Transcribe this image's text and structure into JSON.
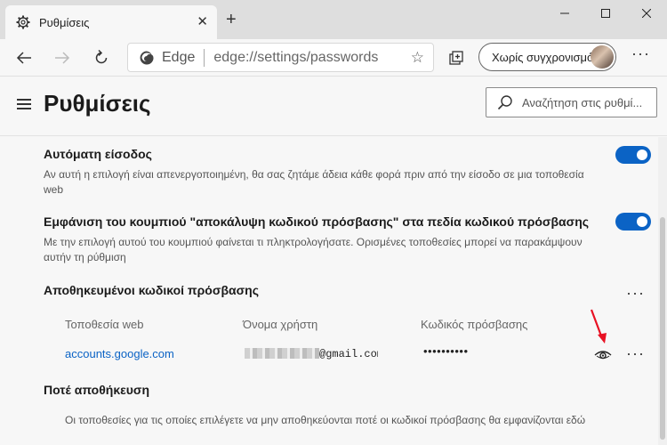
{
  "window": {
    "tab_title": "Ρυθμίσεις",
    "icons": {
      "tab": "gear-icon",
      "close": "close-icon",
      "new_tab": "plus-icon"
    }
  },
  "toolbar": {
    "omnibox_brand": "Edge",
    "url": "edge://settings/passwords",
    "profile_label": "Χωρίς συγχρονισμό",
    "icons": [
      "back-icon",
      "forward-icon",
      "refresh-icon",
      "edge-logo-icon",
      "favorite-star-icon",
      "collections-icon",
      "more-icon"
    ]
  },
  "header": {
    "title": "Ρυθμίσεις",
    "search_placeholder": "Αναζήτηση στις ρυθμί..."
  },
  "settings": {
    "auto_signin": {
      "title": "Αυτόματη είσοδος",
      "description": "Αν αυτή η επιλογή είναι απενεργοποιημένη, θα σας ζητάμε άδεια κάθε φορά πριν από την είσοδο σε μια τοποθεσία web",
      "enabled": true
    },
    "reveal_button": {
      "title": "Εμφάνιση του κουμπιού \"αποκάλυψη κωδικού πρόσβασης\" στα πεδία κωδικού πρόσβασης",
      "description": "Με την επιλογή αυτού του κουμπιού φαίνεται τι πληκτρολογήσατε. Ορισμένες τοποθεσίες μπορεί να παρακάμψουν αυτήν τη ρύθμιση",
      "enabled": true
    }
  },
  "saved_passwords": {
    "title": "Αποθηκευμένοι κωδικοί πρόσβασης",
    "columns": {
      "site": "Τοποθεσία web",
      "username": "Όνομα χρήστη",
      "password": "Κωδικός πρόσβασης"
    },
    "rows": [
      {
        "site": "accounts.google.com",
        "username_suffix": "@gmail.com",
        "password_mask": "••••••••••"
      }
    ]
  },
  "never_saved": {
    "title": "Ποτέ αποθήκευση",
    "description": "Οι τοποθεσίες για τις οποίες επιλέγετε να μην αποθηκεύονται ποτέ οι κωδικοί πρόσβασης θα εμφανίζονται εδώ"
  },
  "colors": {
    "accent": "#0b63c5",
    "annotation_arrow": "#e81123"
  }
}
